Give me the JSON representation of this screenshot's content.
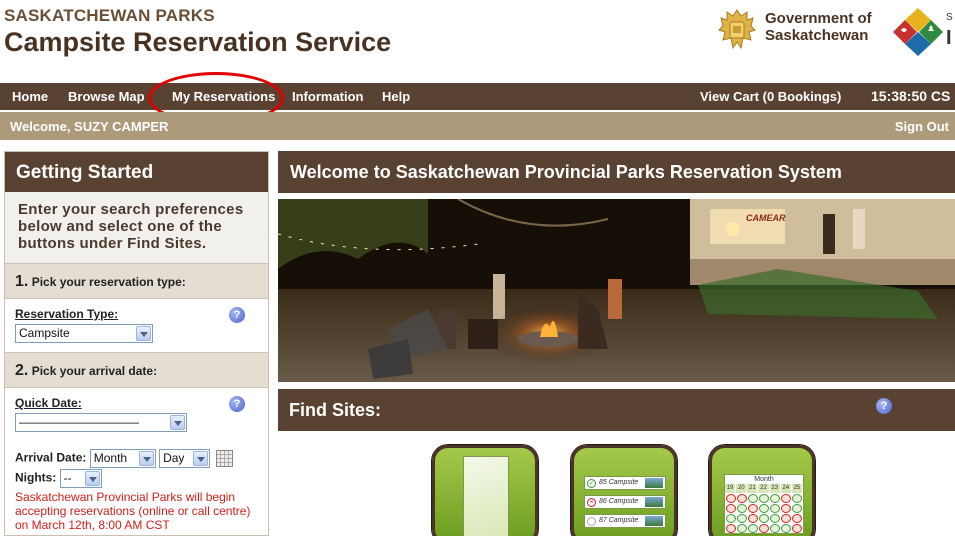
{
  "header": {
    "brand_top": "SASKATCHEWAN PARKS",
    "brand_main": "Campsite Reservation Service",
    "gov_line1": "Government of",
    "gov_line2": "Saskatchewan",
    "parks_cut_small": "S",
    "parks_cut_large": "I"
  },
  "nav": {
    "items": [
      "Home",
      "Browse Map",
      "My Reservations",
      "Information",
      "Help"
    ],
    "cart": "View Cart (0 Bookings)",
    "clock": "15:38:50 CS",
    "highlight_color": "#e00000"
  },
  "welcome": {
    "text": "Welcome, SUZY CAMPER",
    "sign_out": "Sign Out"
  },
  "sidebar": {
    "title": "Getting Started",
    "intro": "Enter your search preferences below and select one of the buttons under Find Sites.",
    "step1_number": "1.",
    "step1_text": "Pick your reservation type:",
    "reservation_type_label": "Reservation Type:",
    "reservation_type_value": "Campsite",
    "step2_number": "2.",
    "step2_text": "Pick your arrival date:",
    "quick_date_label": "Quick Date:",
    "quick_date_value": "——————————",
    "arrival_label": "Arrival Date:",
    "month_value": "Month",
    "day_value": "Day",
    "nights_label": "Nights:",
    "nights_value": "--",
    "notice": "Saskatchewan Provincial Parks will begin accepting reservations (online or call centre) on March 12th, 8:00 AM CST"
  },
  "main": {
    "title": "Welcome to Saskatchewan Provincial Parks Reservation System",
    "find_sites_title": "Find Sites:",
    "hero_sign_text": "CAMEAR"
  },
  "find_buttons": {
    "list_rows": [
      "85 Campsite",
      "86 Campsite",
      "87 Campsite"
    ],
    "calendar_title": "Month",
    "calendar_days": [
      "19",
      "20",
      "21",
      "22",
      "23",
      "24",
      "25"
    ],
    "calendar_pattern": [
      "no",
      "no",
      "ok",
      "ok",
      "ok",
      "no",
      "ok",
      "no",
      "ok",
      "no",
      "ok",
      "ok",
      "no",
      "ok",
      "ok",
      "ok",
      "no",
      "ok",
      "ok",
      "no",
      "no",
      "no",
      "ok",
      "ok",
      "no",
      "ok",
      "ok",
      "no"
    ]
  },
  "colors": {
    "nav_brown": "#5a4232",
    "welcome_tan": "#ad9a7b",
    "button_green": "#8bb83a",
    "notice_red": "#d0201a",
    "help_blue": "#4b63c9"
  }
}
